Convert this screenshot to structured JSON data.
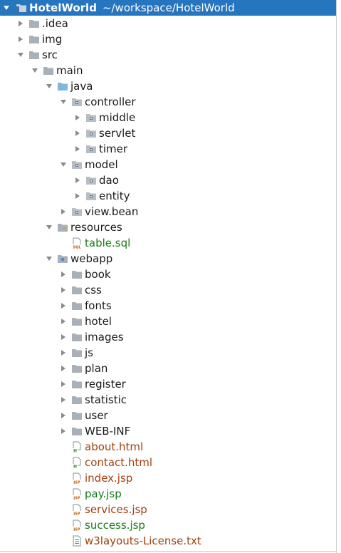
{
  "project": {
    "name": "HotelWorld",
    "path": "~/workspace/HotelWorld"
  },
  "tree": [
    {
      "label": ".idea",
      "depth": 1,
      "arrow": "right",
      "icon": "folder-icon",
      "name": "tree-item-idea"
    },
    {
      "label": "img",
      "depth": 1,
      "arrow": "right",
      "icon": "folder-icon",
      "name": "tree-item-img"
    },
    {
      "label": "src",
      "depth": 1,
      "arrow": "down",
      "icon": "folder-icon",
      "name": "tree-item-src"
    },
    {
      "label": "main",
      "depth": 2,
      "arrow": "down",
      "icon": "folder-icon",
      "name": "tree-item-main"
    },
    {
      "label": "java",
      "depth": 3,
      "arrow": "down",
      "icon": "source-folder-icon",
      "name": "tree-item-java"
    },
    {
      "label": "controller",
      "depth": 4,
      "arrow": "down",
      "icon": "package-icon",
      "name": "tree-item-controller"
    },
    {
      "label": "middle",
      "depth": 5,
      "arrow": "right",
      "icon": "package-icon",
      "name": "tree-item-middle"
    },
    {
      "label": "servlet",
      "depth": 5,
      "arrow": "right",
      "icon": "package-icon",
      "name": "tree-item-servlet"
    },
    {
      "label": "timer",
      "depth": 5,
      "arrow": "right",
      "icon": "package-icon",
      "name": "tree-item-timer"
    },
    {
      "label": "model",
      "depth": 4,
      "arrow": "down",
      "icon": "package-icon",
      "name": "tree-item-model"
    },
    {
      "label": "dao",
      "depth": 5,
      "arrow": "right",
      "icon": "package-icon",
      "name": "tree-item-dao"
    },
    {
      "label": "entity",
      "depth": 5,
      "arrow": "right",
      "icon": "package-icon",
      "name": "tree-item-entity"
    },
    {
      "label": "view.bean",
      "depth": 4,
      "arrow": "right",
      "icon": "package-icon",
      "name": "tree-item-view-bean"
    },
    {
      "label": "resources",
      "depth": 3,
      "arrow": "down",
      "icon": "resources-folder-icon",
      "name": "tree-item-resources"
    },
    {
      "label": "table.sql",
      "depth": 4,
      "arrow": "none",
      "icon": "sql-file-icon",
      "color": "green",
      "name": "tree-item-table-sql"
    },
    {
      "label": "webapp",
      "depth": 3,
      "arrow": "down",
      "icon": "web-folder-icon",
      "name": "tree-item-webapp"
    },
    {
      "label": "book",
      "depth": 4,
      "arrow": "right",
      "icon": "folder-icon",
      "name": "tree-item-book"
    },
    {
      "label": "css",
      "depth": 4,
      "arrow": "right",
      "icon": "folder-icon",
      "name": "tree-item-css"
    },
    {
      "label": "fonts",
      "depth": 4,
      "arrow": "right",
      "icon": "folder-icon",
      "name": "tree-item-fonts"
    },
    {
      "label": "hotel",
      "depth": 4,
      "arrow": "right",
      "icon": "folder-icon",
      "name": "tree-item-hotel"
    },
    {
      "label": "images",
      "depth": 4,
      "arrow": "right",
      "icon": "folder-icon",
      "name": "tree-item-images"
    },
    {
      "label": "js",
      "depth": 4,
      "arrow": "right",
      "icon": "folder-icon",
      "name": "tree-item-js"
    },
    {
      "label": "plan",
      "depth": 4,
      "arrow": "right",
      "icon": "folder-icon",
      "name": "tree-item-plan"
    },
    {
      "label": "register",
      "depth": 4,
      "arrow": "right",
      "icon": "folder-icon",
      "name": "tree-item-register"
    },
    {
      "label": "statistic",
      "depth": 4,
      "arrow": "right",
      "icon": "folder-icon",
      "name": "tree-item-statistic"
    },
    {
      "label": "user",
      "depth": 4,
      "arrow": "right",
      "icon": "folder-icon",
      "name": "tree-item-user"
    },
    {
      "label": "WEB-INF",
      "depth": 4,
      "arrow": "right",
      "icon": "folder-icon",
      "name": "tree-item-web-inf"
    },
    {
      "label": "about.html",
      "depth": 4,
      "arrow": "none",
      "icon": "html-file-icon",
      "color": "brown",
      "name": "tree-item-about-html"
    },
    {
      "label": "contact.html",
      "depth": 4,
      "arrow": "none",
      "icon": "html-file-icon",
      "color": "brown",
      "name": "tree-item-contact-html"
    },
    {
      "label": "index.jsp",
      "depth": 4,
      "arrow": "none",
      "icon": "jsp-file-icon",
      "color": "brown",
      "name": "tree-item-index-jsp"
    },
    {
      "label": "pay.jsp",
      "depth": 4,
      "arrow": "none",
      "icon": "jsp-file-icon",
      "color": "green",
      "name": "tree-item-pay-jsp"
    },
    {
      "label": "services.jsp",
      "depth": 4,
      "arrow": "none",
      "icon": "jsp-file-icon",
      "color": "brown",
      "name": "tree-item-services-jsp"
    },
    {
      "label": "success.jsp",
      "depth": 4,
      "arrow": "none",
      "icon": "jsp-file-icon",
      "color": "green",
      "name": "tree-item-success-jsp"
    },
    {
      "label": "w3layouts-License.txt",
      "depth": 4,
      "arrow": "none",
      "icon": "text-file-icon",
      "color": "brown",
      "name": "tree-item-license-txt"
    }
  ],
  "colors": {
    "selection": "#2675bf",
    "folder": "#a9b0b8",
    "source_folder": "#7fb8de",
    "vcs_added_green": "#1a7a1a",
    "vcs_unversioned_brown": "#a0410c"
  }
}
